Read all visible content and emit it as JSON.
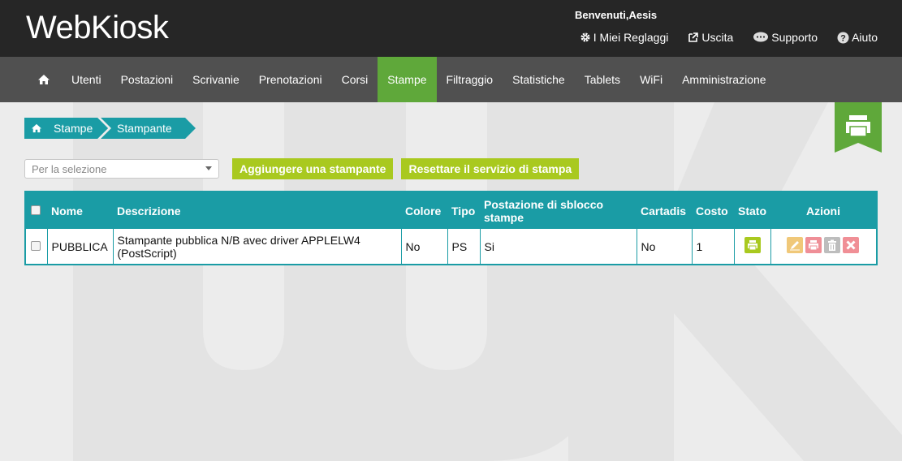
{
  "brand": {
    "logo": "WebKiosk"
  },
  "header": {
    "welcome": "Benvenuti,Aesis",
    "links": [
      {
        "label": "I Miei Reglaggi",
        "icon": "gear-icon"
      },
      {
        "label": "Uscita",
        "icon": "external-link-icon"
      },
      {
        "label": "Supporto",
        "icon": "chat-bubble-icon"
      },
      {
        "label": "Aiuto",
        "icon": "help-circle-icon"
      }
    ]
  },
  "nav": {
    "items": [
      "Utenti",
      "Postazioni",
      "Scrivanie",
      "Prenotazioni",
      "Corsi",
      "Stampe",
      "Filtraggio",
      "Statistiche",
      "Tablets",
      "WiFi",
      "Amministrazione"
    ],
    "active": "Stampe"
  },
  "breadcrumb": {
    "level1": "Stampe",
    "level2": "Stampante"
  },
  "toolbar": {
    "select_placeholder": "Per la selezione",
    "add_printer": "Aggiungere una stampante",
    "reset_service": "Resettare il servizio di stampa"
  },
  "table": {
    "headers": {
      "name": "Nome",
      "description": "Descrizione",
      "color": "Colore",
      "type": "Tipo",
      "unlock_station": "Postazione di sblocco stampe",
      "cartadis": "Cartadis",
      "cost": "Costo",
      "state": "Stato",
      "actions": "Azioni"
    },
    "rows": [
      {
        "name": "PUBBLICA",
        "description": "Stampante pubblica N/B avec driver APPLELW4 (PostScript)",
        "color": "No",
        "type": "PS",
        "unlock_station": "Si",
        "cartadis": "No",
        "cost": "1"
      }
    ]
  },
  "colors": {
    "topbar": "#262626",
    "navbar": "#505050",
    "active_nav": "#5fa83a",
    "teal": "#1a9ca5",
    "lime": "#a9c91f",
    "edit": "#f0c879",
    "print_action": "#ef8f97",
    "delete": "#bdbdbd",
    "remove": "#f08f96"
  }
}
